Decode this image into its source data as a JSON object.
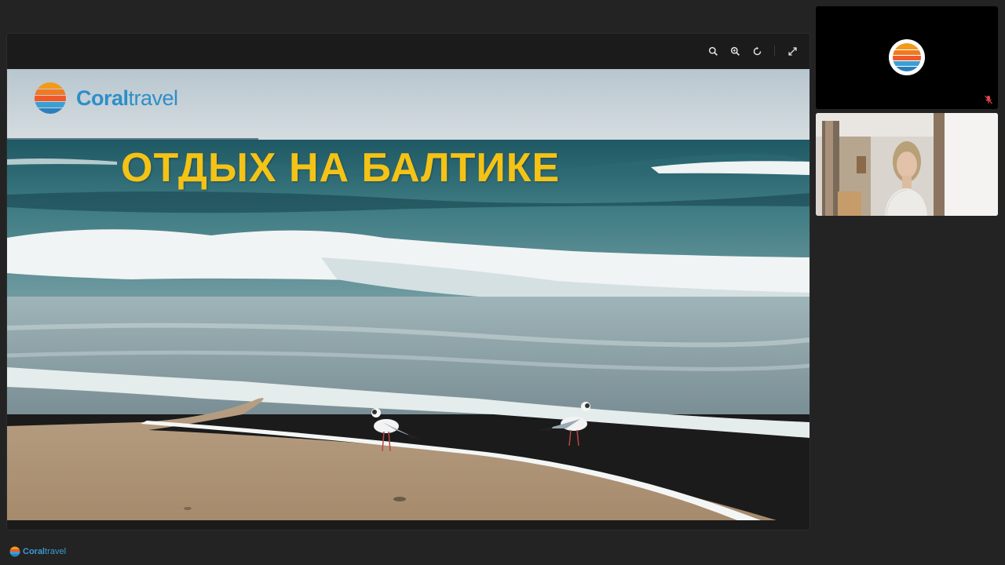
{
  "toolbar": {
    "zoom_out_icon": "zoom-out-icon",
    "zoom_in_icon": "zoom-in-icon",
    "reset_icon": "refresh-icon",
    "fullscreen_icon": "expand-icon"
  },
  "slide": {
    "logo": {
      "brand_bold": "Coral",
      "brand_light": "travel"
    },
    "title": "ОТДЫХ НА БАЛТИКЕ",
    "colors": {
      "title": "#f4c316",
      "logo": "#2c8fc8"
    }
  },
  "participants": [
    {
      "kind": "avatar",
      "muted": true
    },
    {
      "kind": "camera",
      "muted": false
    }
  ],
  "footer": {
    "brand_bold": "Coral",
    "brand_light": "travel"
  }
}
